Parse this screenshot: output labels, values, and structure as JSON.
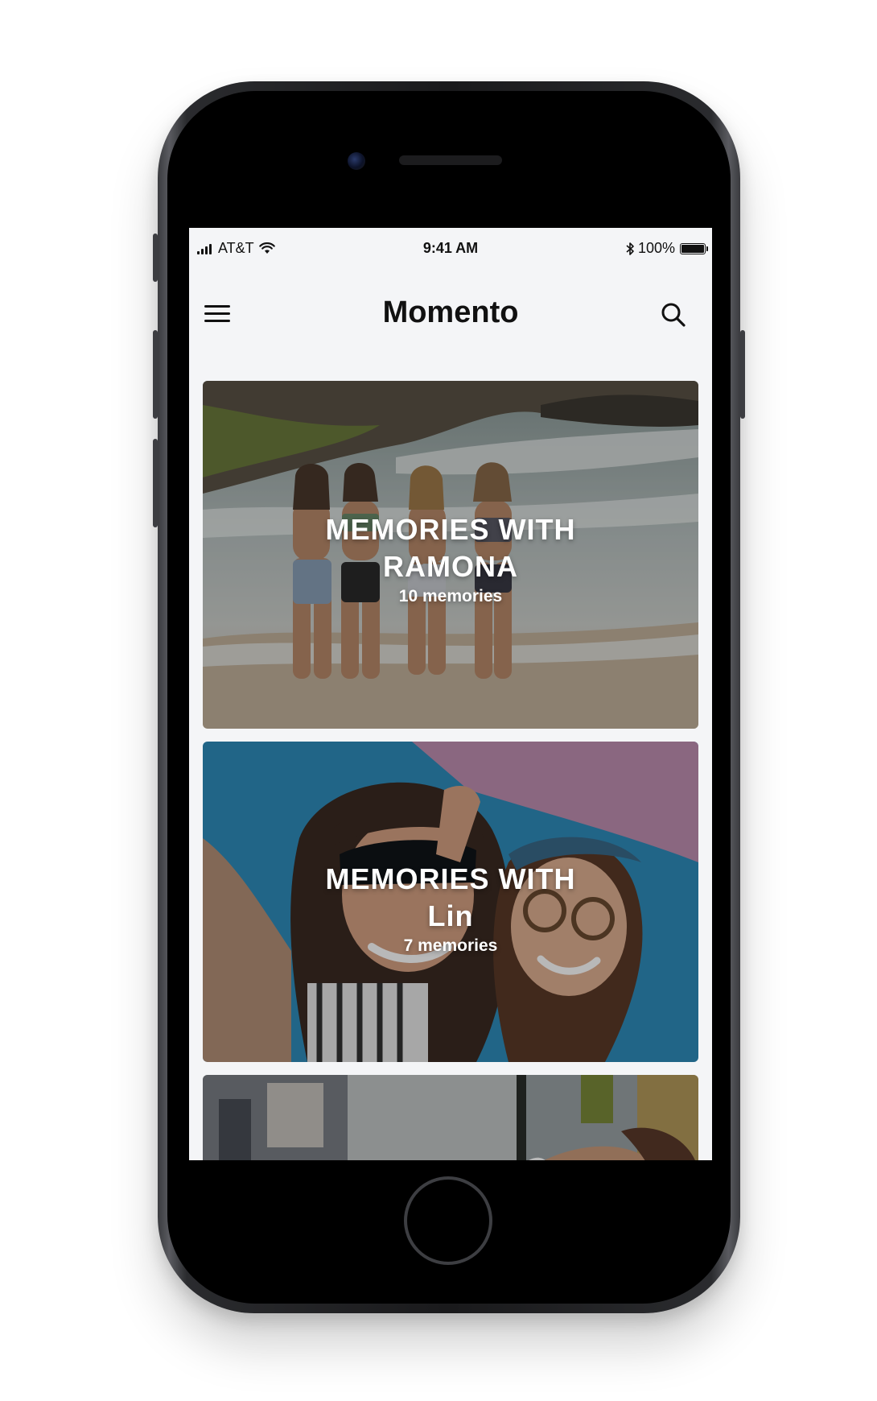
{
  "status_bar": {
    "carrier": "AT&T",
    "time": "9:41 AM",
    "battery": "100%",
    "battery_level": 1.0
  },
  "nav": {
    "title": "Momento",
    "menu_icon": "hamburger-menu-icon",
    "search_icon": "search-icon"
  },
  "cards": [
    {
      "title_line1": "MEMORIES WITH",
      "title_line2": "RAMONA",
      "count": "10 memories"
    },
    {
      "title_line1": "MEMORIES WITH",
      "title_line2": "Lin",
      "count": "7 memories"
    },
    {
      "title_line1": "",
      "title_line2": "",
      "count": ""
    }
  ],
  "colors": {
    "screen_background": "#f4f5f7",
    "text_primary": "#111111",
    "card_text": "#ffffff"
  }
}
